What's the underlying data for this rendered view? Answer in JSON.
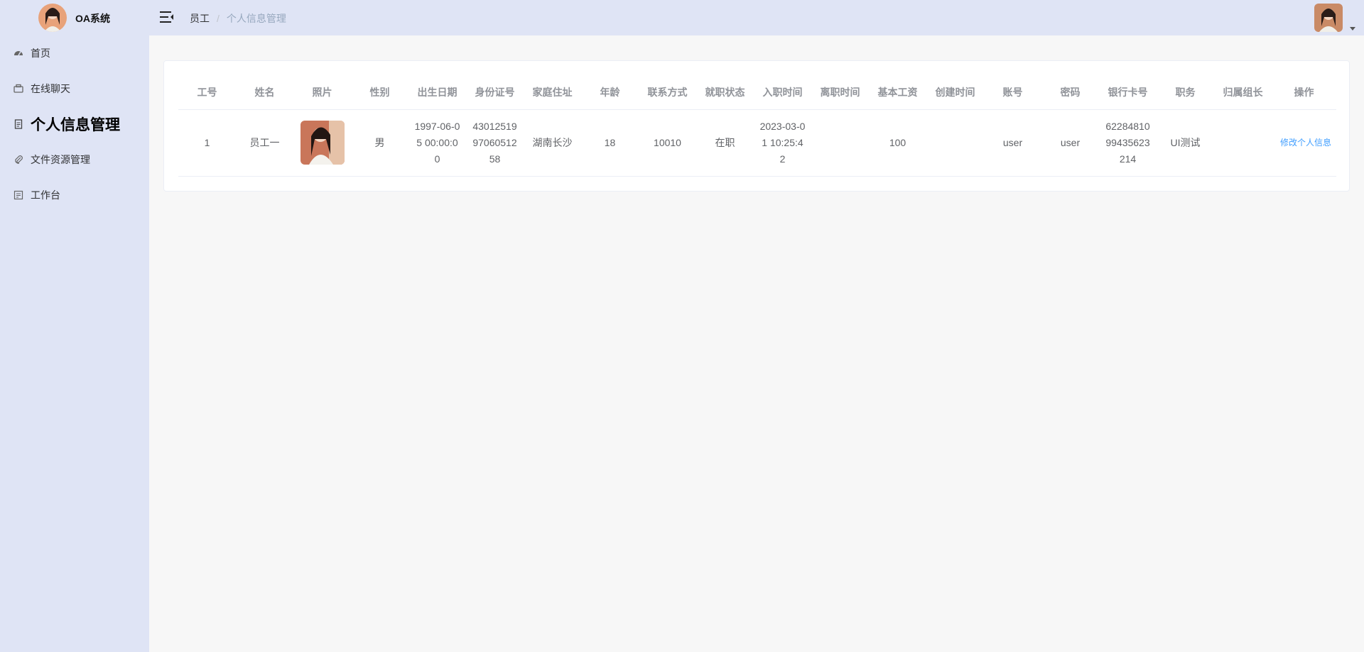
{
  "app": {
    "name": "OA系统"
  },
  "breadcrumb": {
    "parent": "员工",
    "separator": "/",
    "current": "个人信息管理"
  },
  "sidebar": {
    "items": [
      {
        "label": "首页",
        "icon": "dashboard-icon",
        "active": false
      },
      {
        "label": "在线聊天",
        "icon": "chat-icon",
        "active": false
      },
      {
        "label": "个人信息管理",
        "icon": "document-icon",
        "active": true
      },
      {
        "label": "文件资源管理",
        "icon": "paperclip-icon",
        "active": false
      },
      {
        "label": "工作台",
        "icon": "workbench-icon",
        "active": false
      }
    ]
  },
  "table": {
    "columns": [
      "工号",
      "姓名",
      "照片",
      "性别",
      "出生日期",
      "身份证号",
      "家庭住址",
      "年龄",
      "联系方式",
      "就职状态",
      "入职时间",
      "离职时间",
      "基本工资",
      "创建时间",
      "账号",
      "密码",
      "银行卡号",
      "职务",
      "归属组长",
      "操作"
    ],
    "rows": [
      {
        "id": "1",
        "name": "员工一",
        "gender": "男",
        "birth": "1997-06-05 00:00:00",
        "id_card": "430125199706051258",
        "address": "湖南长沙",
        "age": "18",
        "phone": "10010",
        "status": "在职",
        "hire_time": "2023-03-01 10:25:42",
        "leave_time": "",
        "salary": "100",
        "created": "",
        "account": "user",
        "password": "user",
        "bank_card": "6228481099435623214",
        "position": "UI测试",
        "leader": "",
        "action": "修改个人信息"
      }
    ]
  },
  "colors": {
    "sidebar_bg": "#dfe4f5",
    "header_bg": "#dfe4f5",
    "content_bg": "#f7f7f7",
    "link": "#409eff"
  }
}
